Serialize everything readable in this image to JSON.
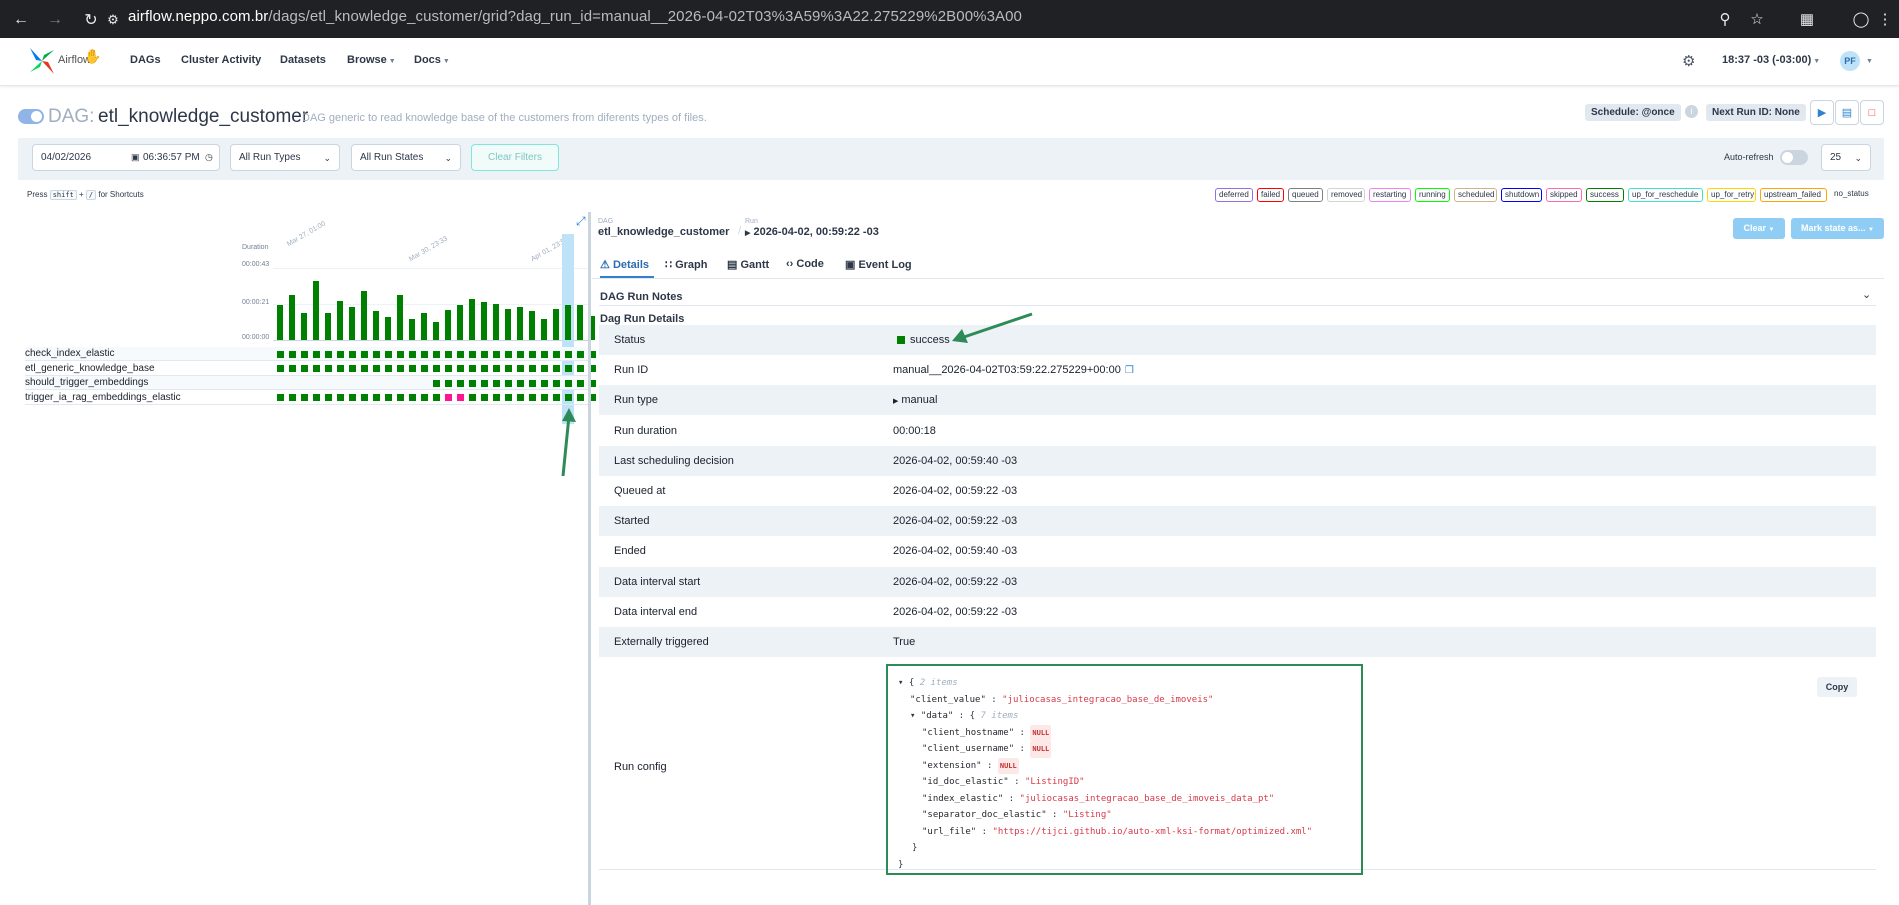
{
  "browser": {
    "url_host": "airflow.neppo.com.br",
    "url_path": "/dags/etl_knowledge_customer/grid?dag_run_id=manual__2026-04-02T03%3A59%3A22.275229%2B00%3A00"
  },
  "header": {
    "logo_text": "Airflow",
    "nav": [
      "DAGs",
      "Cluster Activity",
      "Datasets",
      "Browse",
      "Docs"
    ],
    "time": "18:37 -03 (-03:00)",
    "user_initials": "PF"
  },
  "dag": {
    "label": "DAG:",
    "id": "etl_knowledge_customer",
    "description": "DAG generic to read knowledge base of the customers from diferents types of files.",
    "schedule": "Schedule: @once",
    "next_run": "Next Run ID: None"
  },
  "filters": {
    "date": "04/02/2026",
    "time": "06:36:57 PM",
    "run_types": "All Run Types",
    "run_states": "All Run States",
    "clear_label": "Clear Filters",
    "auto_refresh_label": "Auto-refresh",
    "page_size": "25"
  },
  "shortcut": {
    "press": "Press",
    "key1": "shift",
    "plus": "+",
    "key2": "/",
    "suffix": "for Shortcuts"
  },
  "legend": [
    {
      "label": "deferred",
      "color": "#9370db"
    },
    {
      "label": "failed",
      "color": "#ff0000"
    },
    {
      "label": "queued",
      "color": "#808080"
    },
    {
      "label": "removed",
      "color": "#d3d3d3"
    },
    {
      "label": "restarting",
      "color": "#ee82ee"
    },
    {
      "label": "running",
      "color": "#00ff00"
    },
    {
      "label": "scheduled",
      "color": "#d2b48c"
    },
    {
      "label": "shutdown",
      "color": "#0000ff"
    },
    {
      "label": "skipped",
      "color": "#ff69b4"
    },
    {
      "label": "success",
      "color": "#008000"
    },
    {
      "label": "up_for_reschedule",
      "color": "#40e0d0"
    },
    {
      "label": "up_for_retry",
      "color": "#ffd700"
    },
    {
      "label": "upstream_failed",
      "color": "#ffa500"
    },
    {
      "label": "no_status",
      "color": "#ffffff"
    }
  ],
  "grid": {
    "duration_label": "Duration",
    "y_ticks": [
      "00:00:43",
      "00:00:21",
      "00:00:00"
    ],
    "date_labels": [
      "Mar 27, 01:00",
      "Mar 30, 23:33",
      "Apr 01, 23:59"
    ],
    "run_durations_fraction": [
      0.58,
      0.75,
      0.45,
      0.98,
      0.45,
      0.65,
      0.55,
      0.82,
      0.48,
      0.38,
      0.75,
      0.35,
      0.45,
      0.3,
      0.5,
      0.58,
      0.68,
      0.64,
      0.6,
      0.52,
      0.55,
      0.48,
      0.35,
      0.52,
      0.58,
      0.58,
      0.4
    ],
    "tasks": [
      {
        "name": "check_index_elastic",
        "states": [
          "success",
          "success",
          "success",
          "success",
          "success",
          "success",
          "success",
          "success",
          "success",
          "success",
          "success",
          "success",
          "success",
          "success",
          "success",
          "success",
          "success",
          "success",
          "success",
          "success",
          "success",
          "success",
          "success",
          "success",
          "success",
          "success",
          "success"
        ]
      },
      {
        "name": "etl_generic_knowledge_base",
        "states": [
          "success",
          "success",
          "success",
          "success",
          "success",
          "success",
          "success",
          "success",
          "success",
          "success",
          "success",
          "success",
          "success",
          "success",
          "success",
          "success",
          "success",
          "success",
          "success",
          "success",
          "success",
          "success",
          "success",
          "success",
          "success",
          "success",
          "success"
        ]
      },
      {
        "name": "should_trigger_embeddings",
        "states": [
          "none",
          "none",
          "none",
          "none",
          "none",
          "none",
          "none",
          "none",
          "none",
          "none",
          "none",
          "none",
          "none",
          "success",
          "success",
          "success",
          "success",
          "success",
          "success",
          "success",
          "success",
          "success",
          "success",
          "success",
          "success",
          "success",
          "success"
        ]
      },
      {
        "name": "trigger_ia_rag_embeddings_elastic",
        "states": [
          "success",
          "success",
          "success",
          "success",
          "success",
          "success",
          "success",
          "success",
          "success",
          "success",
          "success",
          "success",
          "success",
          "success",
          "skipped",
          "skipped",
          "success",
          "success",
          "success",
          "success",
          "success",
          "success",
          "success",
          "success",
          "success",
          "success",
          "success"
        ]
      }
    ]
  },
  "run": {
    "breadcrumb_dag_small": "DAG",
    "breadcrumb_dag": "etl_knowledge_customer",
    "breadcrumb_run_small": "Run",
    "breadcrumb_run": "2026-04-02, 00:59:22 -03",
    "clear_label": "Clear",
    "mark_label": "Mark state as..."
  },
  "tabs": [
    "Details",
    "Graph",
    "Gantt",
    "Code",
    "Event Log"
  ],
  "sections": {
    "notes": "DAG Run Notes",
    "details": "Dag Run Details"
  },
  "details": [
    {
      "label": "Status",
      "value": "success"
    },
    {
      "label": "Run ID",
      "value": "manual__2026-04-02T03:59:22.275229+00:00"
    },
    {
      "label": "Run type",
      "value": "manual"
    },
    {
      "label": "Run duration",
      "value": "00:00:18"
    },
    {
      "label": "Last scheduling decision",
      "value": "2026-04-02, 00:59:40 -03"
    },
    {
      "label": "Queued at",
      "value": "2026-04-02, 00:59:22 -03"
    },
    {
      "label": "Started",
      "value": "2026-04-02, 00:59:22 -03"
    },
    {
      "label": "Ended",
      "value": "2026-04-02, 00:59:40 -03"
    },
    {
      "label": "Data interval start",
      "value": "2026-04-02, 00:59:22 -03"
    },
    {
      "label": "Data interval end",
      "value": "2026-04-02, 00:59:22 -03"
    },
    {
      "label": "Externally triggered",
      "value": "True"
    }
  ],
  "run_config": {
    "label": "Run config",
    "copy_label": "Copy",
    "root_count": "2 items",
    "data_count": "7 items",
    "null_label": "NULL",
    "keys": {
      "client_value": "\"client_value\"",
      "data": "\"data\"",
      "client_hostname": "\"client_hostname\"",
      "client_username": "\"client_username\"",
      "extension": "\"extension\"",
      "id_doc_elastic": "\"id_doc_elastic\"",
      "index_elastic": "\"index_elastic\"",
      "separator_doc_elastic": "\"separator_doc_elastic\"",
      "url_file": "\"url_file\""
    },
    "values": {
      "client_value": "\"juliocasas_integracao_base_de_imoveis\"",
      "id_doc_elastic": "\"ListingID\"",
      "index_elastic": "\"juliocasas_integracao_base_de_imoveis_data_pt\"",
      "separator_doc_elastic": "\"Listing\"",
      "url_file": "\"https://tijci.github.io/auto-xml-ksi-format/optimized.xml\""
    }
  },
  "colors": {
    "success": "#008000",
    "skipped": "#ff1493",
    "annotation": "#2e8b57",
    "selected_run": "#bee3f8"
  }
}
